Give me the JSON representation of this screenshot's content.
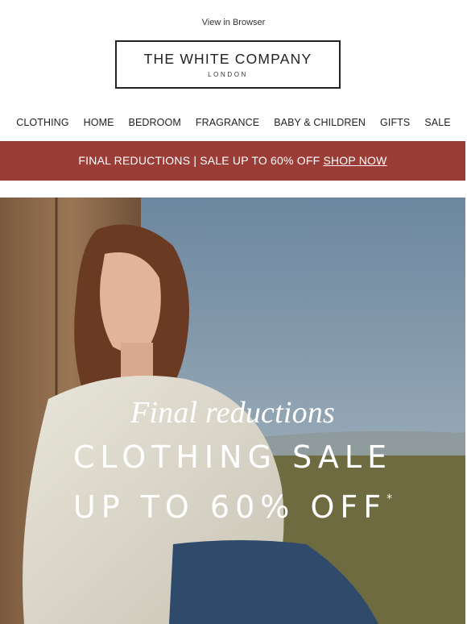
{
  "header": {
    "view_in_browser": "View in Browser"
  },
  "logo": {
    "name": "THE WHITE COMPANY",
    "sub": "LONDON"
  },
  "nav": {
    "items": [
      "CLOTHING",
      "HOME",
      "BEDROOM",
      "FRAGRANCE",
      "BABY & CHILDREN",
      "GIFTS",
      "SALE"
    ]
  },
  "promo": {
    "text": "FINAL REDUCTIONS | SALE UP TO 60% OFF ",
    "link": "SHOP NOW",
    "color": "#9b3d36"
  },
  "hero": {
    "script": "Final reductions",
    "headline": "CLOTHING SALE",
    "offer": "UP TO 60% OFF",
    "asterisk": "*"
  }
}
